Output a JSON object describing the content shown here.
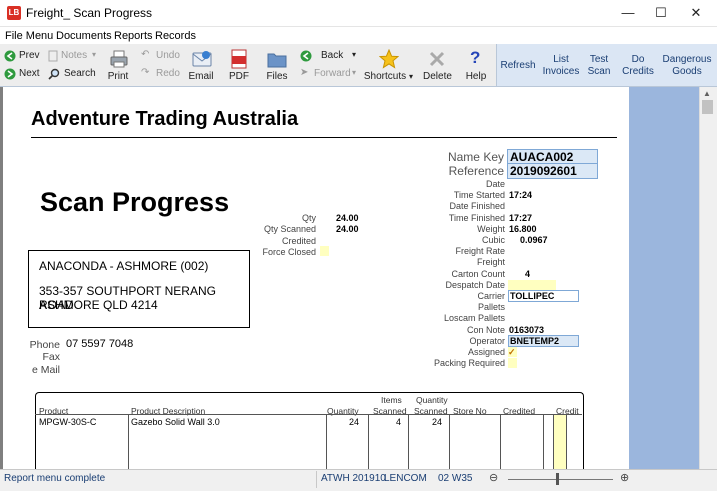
{
  "window": {
    "title": "Freight_ Scan Progress",
    "app_icon": "app-logo-icon"
  },
  "menu": [
    "File Menu",
    "Documents",
    "Reports",
    "Records"
  ],
  "toolbar": {
    "prev": "Prev",
    "next": "Next",
    "notes": "Notes",
    "search": "Search",
    "undo": "Undo",
    "redo": "Redo",
    "print": "Print",
    "email": "Email",
    "pdf": "PDF",
    "files": "Files",
    "back": "Back",
    "forward": "Forward",
    "shortcuts": "Shortcuts",
    "delete": "Delete",
    "help": "Help"
  },
  "toolbar_right": {
    "refresh": "Refresh",
    "list_invoices": [
      "List",
      "Invoices"
    ],
    "test_scan": [
      "Test",
      "Scan"
    ],
    "do_credits": [
      "Do",
      "Credits"
    ],
    "dangerous_goods": [
      "Dangerous",
      "Goods"
    ]
  },
  "report": {
    "company": "Adventure Trading Australia",
    "title": "Scan Progress",
    "name_key_label": "Name Key",
    "name_key": "AUACA002",
    "reference_label": "Reference",
    "reference": "2019092601",
    "left_fields": [
      {
        "label": "Qty",
        "value": "24.00"
      },
      {
        "label": "Qty Scanned",
        "value": "24.00"
      },
      {
        "label": "Credited",
        "value": ""
      },
      {
        "label": "Force Closed",
        "value": ""
      }
    ],
    "right_fields": [
      {
        "label": "Date",
        "value": ""
      },
      {
        "label": "Time Started",
        "value": "17:24"
      },
      {
        "label": "Date Finished",
        "value": ""
      },
      {
        "label": "Time Finished",
        "value": "17:27"
      },
      {
        "label": "Weight",
        "value": "16.800"
      },
      {
        "label": "Cubic",
        "value": "0.0967"
      },
      {
        "label": "Freight Rate",
        "value": ""
      },
      {
        "label": "Freight",
        "value": ""
      },
      {
        "label": "Carton Count",
        "value": "4"
      },
      {
        "label": "Despatch Date",
        "value": ""
      },
      {
        "label": "Carrier",
        "value": "TOLLIPEC"
      },
      {
        "label": "Pallets",
        "value": ""
      },
      {
        "label": "Loscam Pallets",
        "value": ""
      },
      {
        "label": "Con Note",
        "value": "0163073"
      },
      {
        "label": "Operator",
        "value": "BNETEMP2"
      },
      {
        "label": "Assigned",
        "value": "✓"
      },
      {
        "label": "Packing Required",
        "value": ""
      }
    ],
    "address": [
      "ANACONDA - ASHMORE (002)",
      "353-357 SOUTHPORT NERANG ROAD",
      "ASHMORE QLD 4214"
    ],
    "phone_label": "Phone",
    "phone": "07 5597 7048",
    "fax_label": "Fax",
    "email_label": "e Mail",
    "table": {
      "headers": {
        "product": "Product",
        "description": "Product Description",
        "quantity": "Quantity",
        "items_scanned": [
          "Items",
          "Scanned"
        ],
        "qty_scanned": [
          "Quantity",
          "Scanned"
        ],
        "store_no": "Store No",
        "credited": "Credited",
        "credit": "Credit"
      },
      "rows": [
        {
          "product": "MPGW-30S-C",
          "description": "Gazebo Solid Wall 3.0",
          "quantity": "24",
          "items_scanned": "4",
          "qty_scanned": "24",
          "store_no": "",
          "credited": "",
          "credit": ""
        }
      ]
    }
  },
  "status": {
    "message": "Report menu complete",
    "period": "ATWH 201910",
    "user": "LENCOM",
    "week": "02 W35"
  },
  "colors": {
    "side_panel": "#9bb6dd",
    "highlight_yellow": "#ffffc0",
    "field_blue": "#dbe8f6"
  }
}
